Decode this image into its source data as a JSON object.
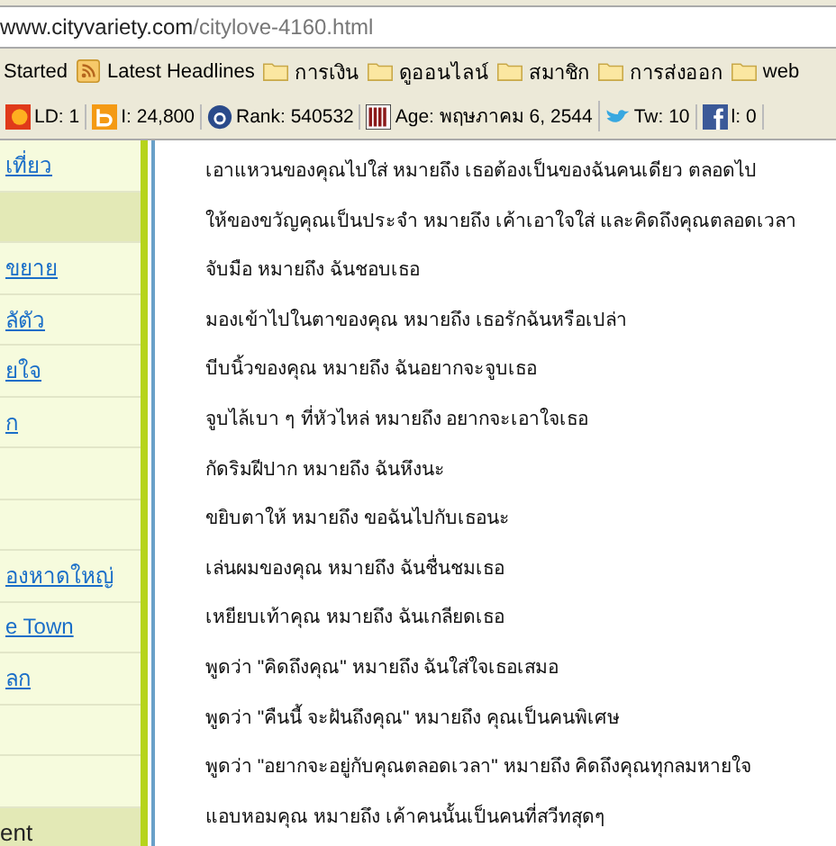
{
  "address_bar": {
    "host": "www.cityvariety.com",
    "path": "/citylove-4160.html"
  },
  "bookmarks": [
    {
      "kind": "plain",
      "label": "Started"
    },
    {
      "kind": "feed",
      "label": "Latest Headlines"
    },
    {
      "kind": "folder",
      "label": "การเงิน"
    },
    {
      "kind": "folder",
      "label": "ดูออนไลน์"
    },
    {
      "kind": "folder",
      "label": "สมาชิก"
    },
    {
      "kind": "folder",
      "label": "การส่งออก"
    },
    {
      "kind": "folder",
      "label": "web"
    }
  ],
  "stats": [
    {
      "kind": "flame",
      "label": "LD: 1"
    },
    {
      "kind": "b",
      "label": "I: 24,800"
    },
    {
      "kind": "a",
      "label": "Rank: 540532"
    },
    {
      "kind": "bars",
      "label": "Age: พฤษภาคม 6, 2544"
    },
    {
      "kind": "bird",
      "label": "Tw: 10"
    },
    {
      "kind": "f",
      "label": "l: 0"
    }
  ],
  "sidebar": {
    "items": [
      {
        "kind": "link",
        "label": "เที่ยว"
      },
      {
        "kind": "header"
      },
      {
        "kind": "link",
        "label": "ขยาย"
      },
      {
        "kind": "link",
        "label": "ลัตัว"
      },
      {
        "kind": "link",
        "label": "ยใจ"
      },
      {
        "kind": "link",
        "label": "ก"
      },
      {
        "kind": "empty"
      },
      {
        "kind": "empty"
      },
      {
        "kind": "link",
        "label": "องหาดใหญ่"
      },
      {
        "kind": "link",
        "label": "e Town"
      },
      {
        "kind": "link",
        "label": "ลก"
      },
      {
        "kind": "empty"
      },
      {
        "kind": "empty"
      },
      {
        "kind": "header",
        "label": "ent"
      }
    ]
  },
  "content": {
    "lines": [
      "เอาแหวนของคุณไปใส่ หมายถึง เธอต้องเป็นของฉันคนเดียว ตลอดไป",
      "ให้ของขวัญคุณเป็นประจำ หมายถึง เค้าเอาใจใส่ และคิดถึงคุณตลอดเวลา",
      "จับมือ หมายถึง ฉันชอบเธอ",
      "มองเข้าไปในตาของคุณ หมายถึง เธอรักฉันหรือเปล่า",
      "บีบนิ้วของคุณ หมายถึง ฉันอยากจะจูบเธอ",
      "จูบไล้เบา ๆ ที่หัวไหล่ หมายถึง อยากจะเอาใจเธอ",
      "กัดริมฝีปาก หมายถึง ฉันหึงนะ",
      "ขยิบตาให้ หมายถึง ขอฉันไปกับเธอนะ",
      "เล่นผมของคุณ หมายถึง ฉันชื่นชมเธอ",
      "เหยียบเท้าคุณ หมายถึง ฉันเกลียดเธอ",
      "พูดว่า \"คิดถึงคุณ\" หมายถึง ฉันใส่ใจเธอเสมอ",
      "พูดว่า \"คืนนี้ จะฝันถึงคุณ\" หมายถึง คุณเป็นคนพิเศษ",
      "พูดว่า \"อยากจะอยู่กับคุณตลอดเวลา\" หมายถึง คิดถึงคุณทุกลมหายใจ",
      "แอบหอมคุณ หมายถึง เค้าคนนั้นเป็นคนที่สวีทสุดๆ"
    ]
  }
}
